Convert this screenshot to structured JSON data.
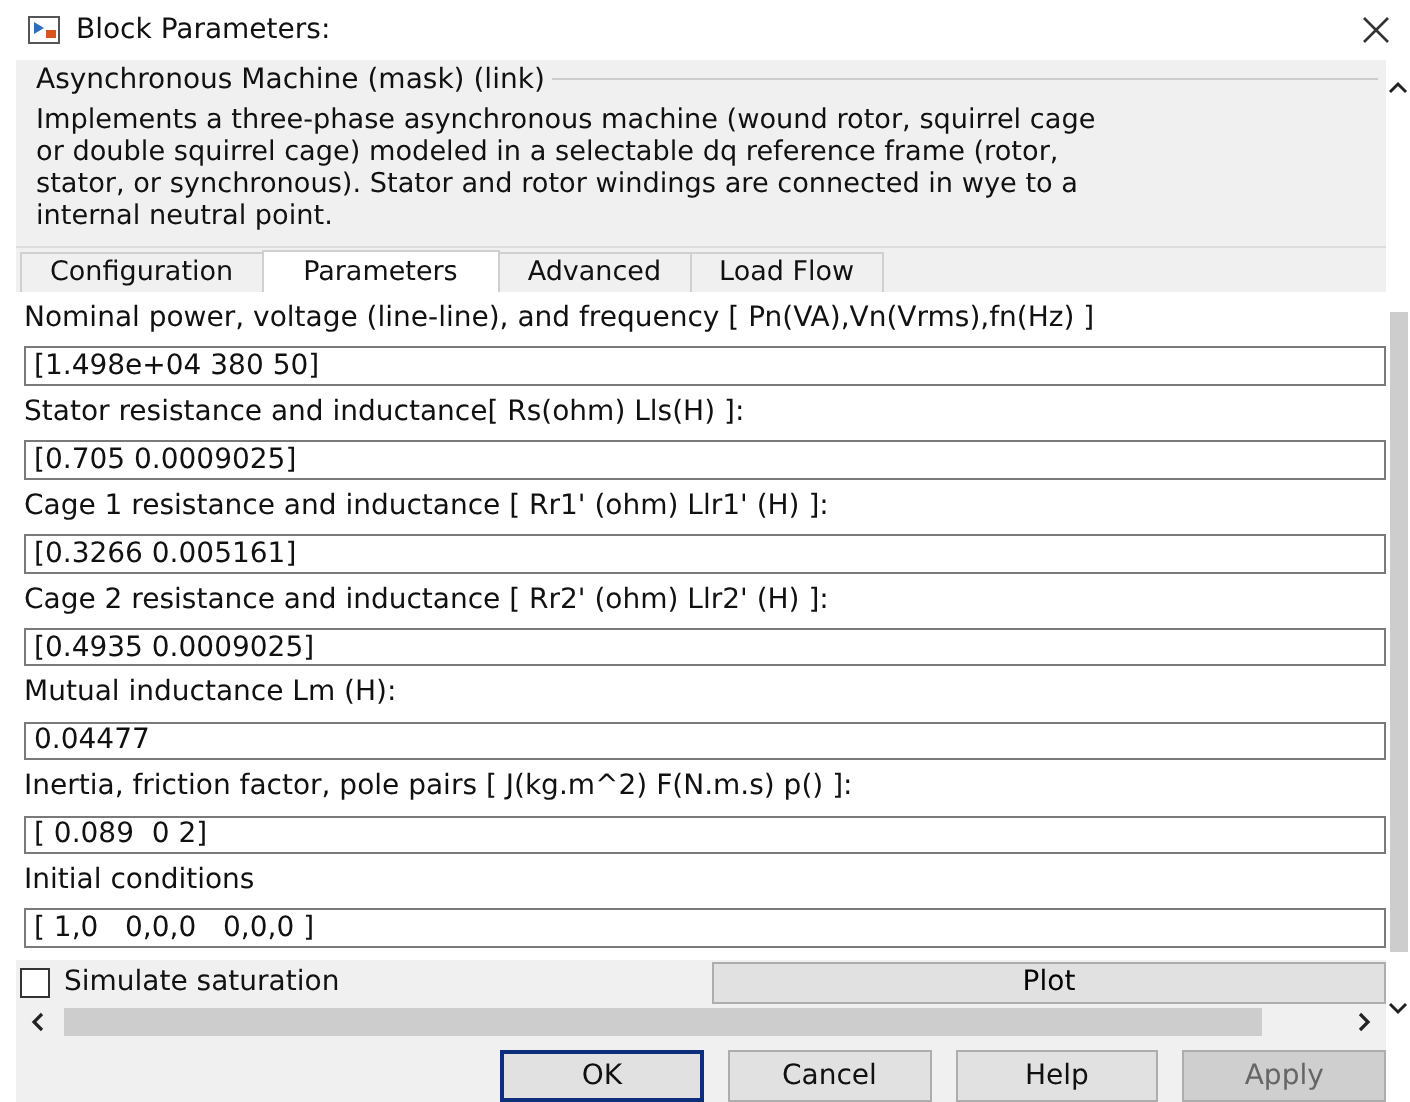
{
  "window": {
    "title": "Block Parameters:"
  },
  "group": {
    "title": "Asynchronous Machine (mask) (link)",
    "description_lines": [
      "Implements a three-phase asynchronous machine (wound rotor, squirrel cage",
      "or double squirrel cage) modeled in a selectable dq reference frame (rotor,",
      "stator, or synchronous). Stator and rotor windings are connected in wye to a",
      "internal neutral point."
    ]
  },
  "tabs": [
    {
      "label": "Configuration",
      "selected": false
    },
    {
      "label": "Parameters",
      "selected": true
    },
    {
      "label": "Advanced",
      "selected": false
    },
    {
      "label": "Load Flow",
      "selected": false
    }
  ],
  "parameters": [
    {
      "label": "Nominal power, voltage (line-line), and frequency [ Pn(VA),Vn(Vrms),fn(Hz) ]",
      "value": "[1.498e+04 380 50]"
    },
    {
      "label": "Stator resistance and inductance[ Rs(ohm)  Lls(H) ]:",
      "value": "[0.705 0.0009025]"
    },
    {
      "label": "Cage 1 resistance and inductance  [ Rr1' (ohm)  Llr1' (H) ]:",
      "value": "[0.3266 0.005161]"
    },
    {
      "label": "Cage 2 resistance and inductance  [ Rr2' (ohm)  Llr2' (H) ]:",
      "value": "[0.4935 0.0009025]"
    },
    {
      "label": "Mutual inductance Lm (H):",
      "value": "0.04477"
    },
    {
      "label": "Inertia, friction factor, pole pairs [ J(kg.m^2)  F(N.m.s)   p() ]:",
      "value": "[ 0.089  0 2]"
    },
    {
      "label": "Initial conditions",
      "value": "[ 1,0   0,0,0   0,0,0 ]"
    }
  ],
  "saturation": {
    "label": "Simulate saturation",
    "checked": false
  },
  "plot_button": "Plot",
  "buttons": [
    {
      "label": "OK",
      "default": true,
      "disabled": false
    },
    {
      "label": "Cancel",
      "default": false,
      "disabled": false
    },
    {
      "label": "Help",
      "default": false,
      "disabled": false
    },
    {
      "label": "Apply",
      "default": false,
      "disabled": true
    }
  ]
}
